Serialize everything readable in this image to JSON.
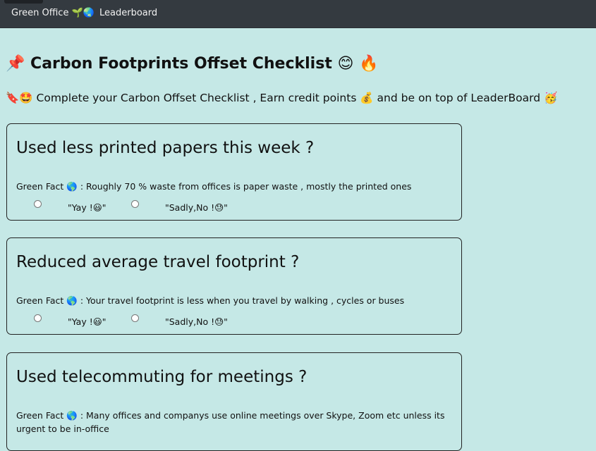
{
  "nav": {
    "brand": "Green Office 🌱🌏",
    "leaderboard": "Leaderboard"
  },
  "header": {
    "title": "📌 Carbon Footprints Offset Checklist 😊 🔥",
    "subtitle": "🔖🤩 Complete your Carbon Offset Checklist , Earn credit points 💰 and be on top of LeaderBoard 🥳"
  },
  "checklist": [
    {
      "question": "Used less printed papers this week ?",
      "fact": "Green Fact 🌎 : Roughly 70 % waste from offices is paper waste , mostly the printed ones",
      "yes": "\"Yay !😃\"",
      "no": "\"Sadly,No !😓\""
    },
    {
      "question": "Reduced average travel footprint ?",
      "fact": "Green Fact 🌎 : Your travel footprint is less when you travel by walking , cycles or buses",
      "yes": "\"Yay !😃\"",
      "no": "\"Sadly,No !😓\""
    },
    {
      "question": "Used telecommuting for meetings ?",
      "fact": "Green Fact 🌎 : Many offices and companys use online meetings over Skype, Zoom etc unless its urgent to be in-office"
    }
  ]
}
